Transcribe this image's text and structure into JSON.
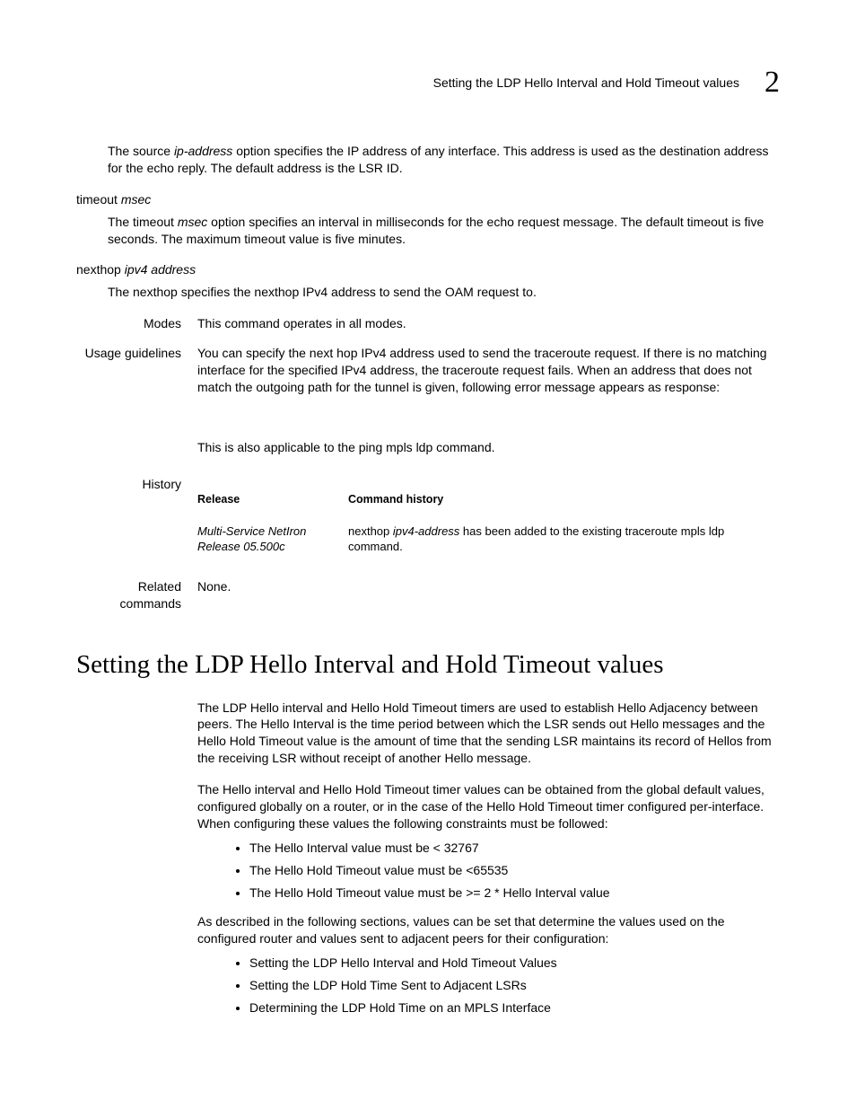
{
  "header": {
    "running_title": "Setting the LDP Hello Interval and Hold Timeout values",
    "chapter_number": "2"
  },
  "source_opt": {
    "text_before": "The source ",
    "term": "ip-address",
    "text_after": " option specifies the IP address of any interface. This address is used as the destination address for the echo reply. The default address is the LSR ID."
  },
  "timeout_opt": {
    "label_before": "timeout ",
    "label_term": "msec",
    "desc_before": "The timeout ",
    "desc_term": "msec",
    "desc_after": " option specifies an interval in milliseconds for the echo request message. The default timeout is five seconds. The maximum timeout value is five minutes."
  },
  "nexthop_opt": {
    "label_before": "nexthop ",
    "label_term": "ipv4 address",
    "desc": "The nexthop specifies the nexthop IPv4 address to send the OAM request to."
  },
  "modes": {
    "label": "Modes",
    "text": "This command operates in all modes."
  },
  "usage": {
    "label": "Usage guidelines",
    "para1": "You can specify the next hop IPv4 address used to send the traceroute request. If there is no matching interface for the specified IPv4 address, the traceroute request fails. When an address that does not match the outgoing path for the tunnel is given, following error message appears as response:",
    "para2": "This is also applicable to the ping mpls ldp command."
  },
  "history": {
    "label": "History",
    "col1_head": "Release",
    "col2_head": "Command history",
    "release": "Multi-Service NetIron Release 05.500c",
    "change_before": "nexthop ",
    "change_term": "ipv4-address",
    "change_after": " has been added to the existing traceroute mpls ldp command."
  },
  "related": {
    "label1": "Related",
    "label2": "commands",
    "text": "None."
  },
  "section": {
    "title": "Setting the LDP Hello Interval and Hold Timeout values",
    "p1": "The LDP Hello interval and Hello Hold Timeout timers are used to establish Hello Adjacency between peers. The Hello Interval is the time period between which the LSR sends out Hello messages and the Hello Hold Timeout value is the amount of time that the sending LSR maintains its record of Hellos from the receiving LSR without receipt of another Hello message.",
    "p2": "The Hello interval and Hello Hold Timeout timer values can be obtained from the global default values, configured globally on a router, or in the case of the Hello Hold Timeout timer configured per-interface. When configuring these values the following constraints must be followed:",
    "bullets1": [
      "The Hello Interval value must be < 32767",
      "The Hello Hold Timeout value must be <65535",
      "The Hello Hold Timeout value must be >= 2 * Hello Interval value"
    ],
    "p3": "As described in the following sections, values can be set that determine the values used on the configured router and values sent to adjacent peers for their configuration:",
    "bullets2": [
      "Setting the LDP Hello Interval and Hold Timeout Values",
      "Setting the LDP Hold Time Sent to Adjacent LSRs",
      "Determining the LDP Hold Time on an MPLS Interface"
    ]
  }
}
